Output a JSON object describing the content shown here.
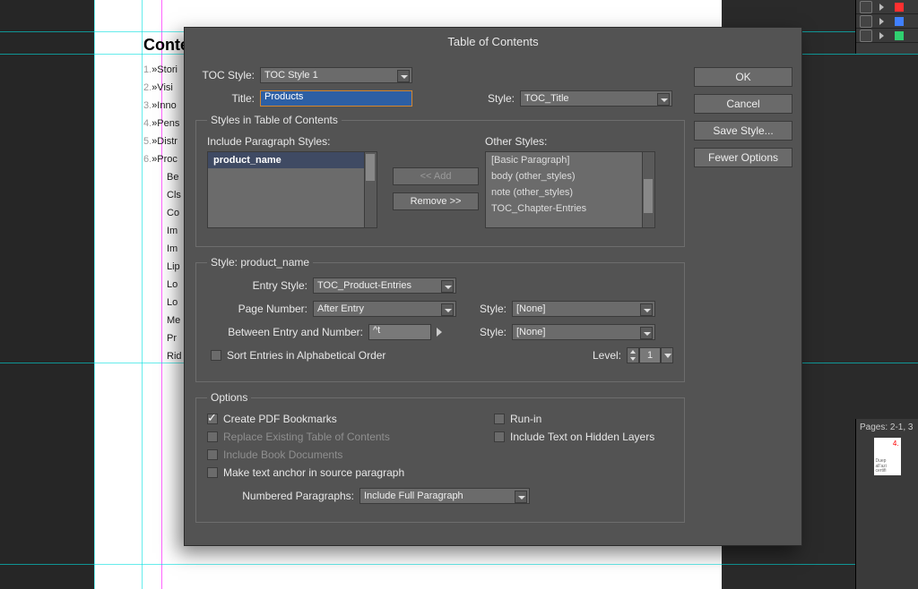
{
  "document": {
    "title": "Conte",
    "items": [
      {
        "n": "1.",
        "t": "»Stori"
      },
      {
        "n": "2.",
        "t": "»Visi"
      },
      {
        "n": "3.",
        "t": "»Inno"
      },
      {
        "n": "4.",
        "t": "»Pens"
      },
      {
        "n": "5.",
        "t": "»Distr"
      },
      {
        "n": "6.",
        "t": "»Proc"
      }
    ],
    "subitems": [
      "Be",
      "Cls",
      "Co",
      "Im",
      "Im",
      "Lip",
      "Lo",
      "Lo",
      "Me",
      "Pr",
      "Rid"
    ]
  },
  "dialog": {
    "title": "Table of Contents",
    "toc_style_label": "TOC Style:",
    "toc_style_value": "TOC Style 1",
    "title_label": "Title:",
    "title_value": "Products",
    "style_label": "Style:",
    "style_value": "TOC_Title",
    "side": {
      "ok": "OK",
      "cancel": "Cancel",
      "save": "Save Style...",
      "fewer": "Fewer Options"
    },
    "styles_group": {
      "legend": "Styles in Table of Contents",
      "include_label": "Include Paragraph Styles:",
      "other_label": "Other Styles:",
      "include_items": [
        "product_name"
      ],
      "other_items": [
        "[Basic Paragraph]",
        "body (other_styles)",
        "note (other_styles)",
        "TOC_Chapter-Entries"
      ],
      "add": "<< Add",
      "remove": "Remove >>"
    },
    "style_detail": {
      "legend": "Style: product_name",
      "entry_style_label": "Entry Style:",
      "entry_style_value": "TOC_Product-Entries",
      "page_number_label": "Page Number:",
      "page_number_value": "After Entry",
      "between_label": "Between Entry and Number:",
      "between_value": "^t",
      "pn_style_label": "Style:",
      "pn_style_value": "[None]",
      "be_style_label": "Style:",
      "be_style_value": "[None]",
      "sort_label": "Sort Entries in Alphabetical Order",
      "level_label": "Level:",
      "level_value": "1"
    },
    "options": {
      "legend": "Options",
      "pdf": "Create PDF Bookmarks",
      "replace": "Replace Existing Table of Contents",
      "book": "Include Book Documents",
      "anchor": "Make text anchor in source paragraph",
      "runin": "Run-in",
      "hidden": "Include Text on Hidden Layers",
      "np_label": "Numbered Paragraphs:",
      "np_value": "Include Full Paragraph"
    }
  },
  "pages_footer": "Pages: 2-1, 3",
  "thumb": {
    "p4": "4.",
    "l1": "Duep",
    "l2": "all'azi",
    "l3": "certifi"
  }
}
